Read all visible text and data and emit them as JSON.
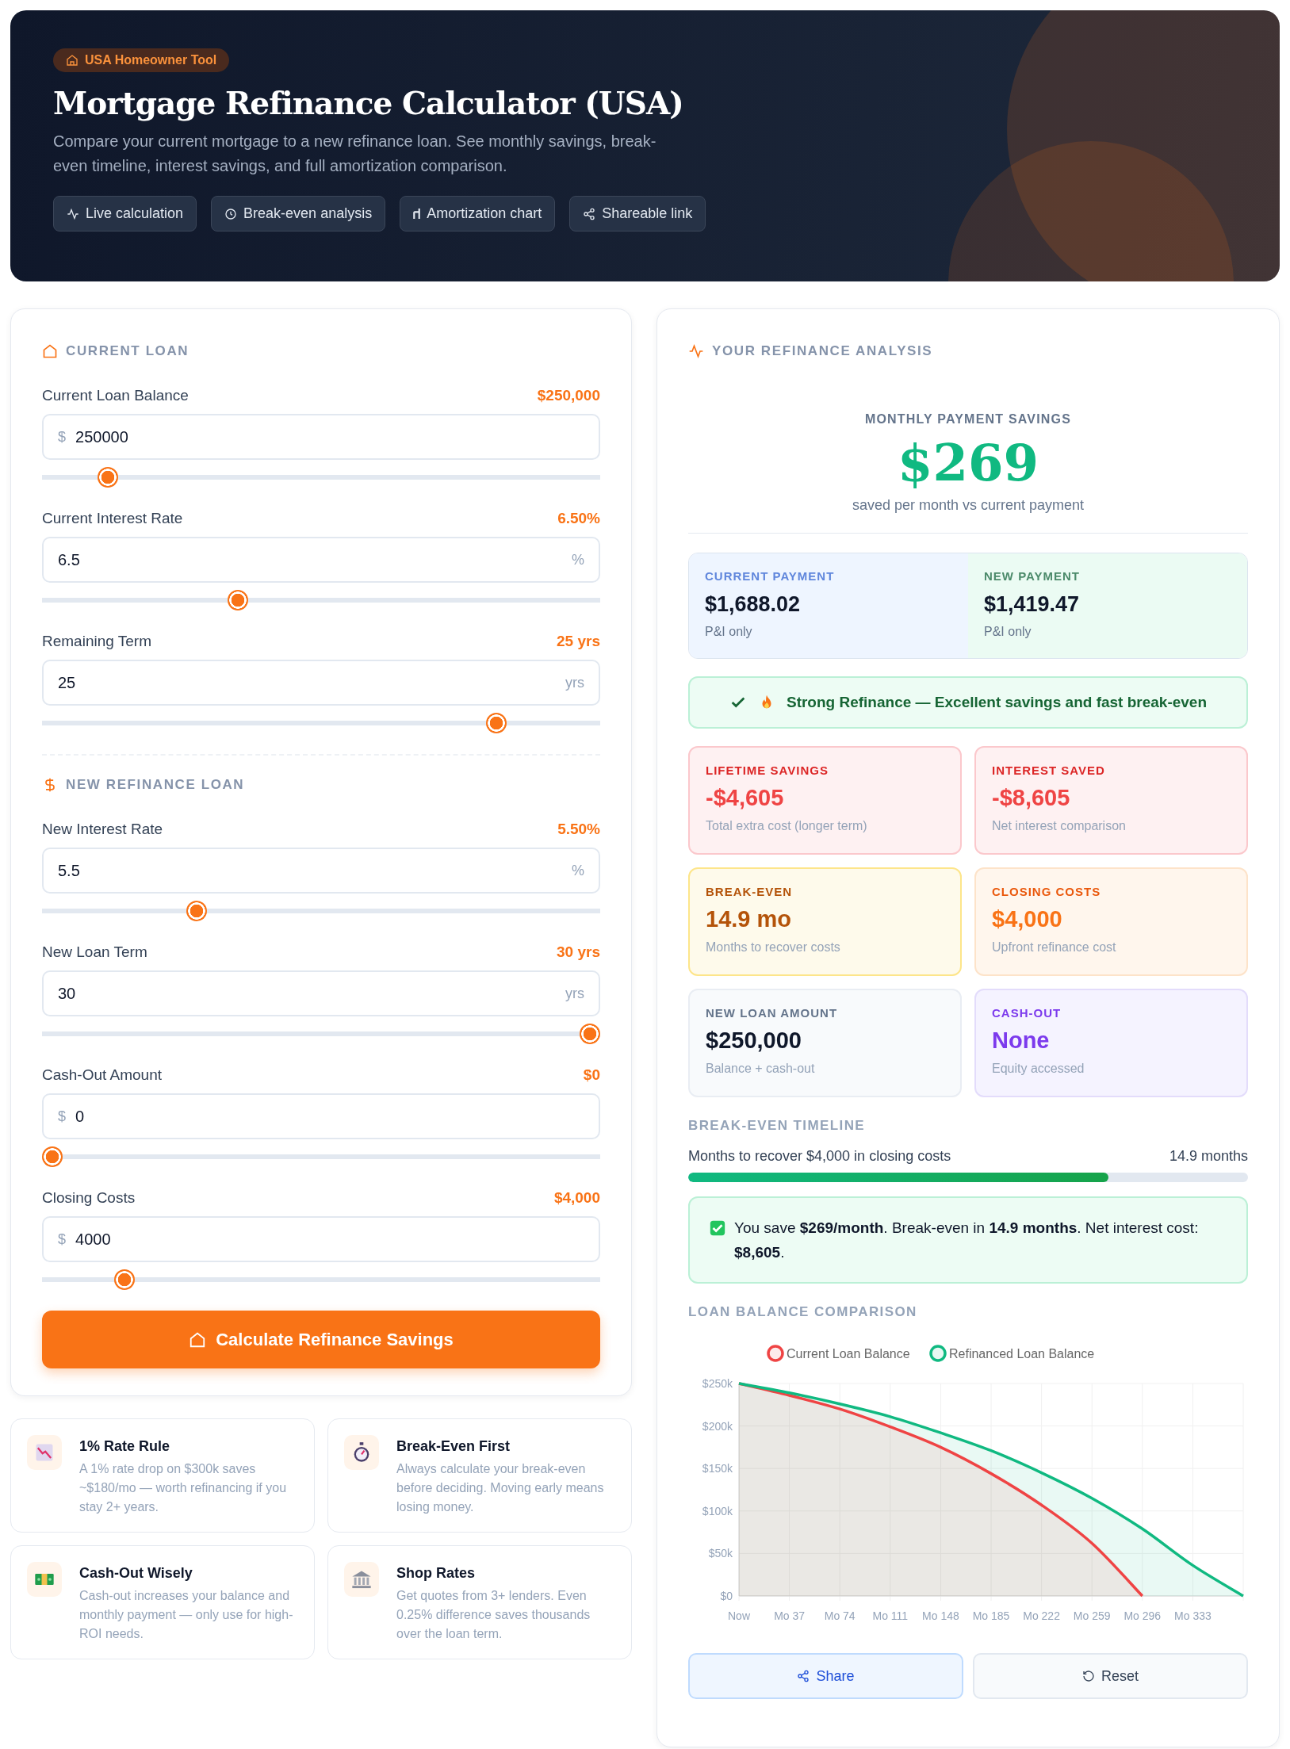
{
  "header": {
    "badge": "USA Homeowner Tool",
    "title": "Mortgage Refinance Calculator (USA)",
    "subtitle": "Compare your current mortgage to a new refinance loan. See monthly savings, break-even timeline, interest savings, and full amortization comparison.",
    "features": [
      "Live calculation",
      "Break-even analysis",
      "Amortization chart",
      "Shareable link"
    ]
  },
  "current_loan": {
    "title": "CURRENT LOAN",
    "fields": [
      {
        "label": "Current Loan Balance",
        "reading": "$250,000",
        "prefix": "$",
        "value": "250000",
        "level": 0.103
      },
      {
        "label": "Current Interest Rate",
        "reading": "6.50%",
        "suffix": "%",
        "value": "6.5",
        "level": 0.345
      },
      {
        "label": "Remaining Term",
        "reading": "25 yrs",
        "suffix": "yrs",
        "value": "25",
        "level": 0.826
      }
    ]
  },
  "new_loan": {
    "title": "NEW REFINANCE LOAN",
    "fields": [
      {
        "label": "New Interest Rate",
        "reading": "5.50%",
        "suffix": "%",
        "value": "5.5",
        "level": 0.269
      },
      {
        "label": "New Loan Term",
        "reading": "30 yrs",
        "suffix": "yrs",
        "value": "30",
        "level": 1.0
      },
      {
        "label": "Cash-Out Amount",
        "reading": "$0",
        "prefix": "$",
        "value": "0",
        "level": 0
      },
      {
        "label": "Closing Costs",
        "reading": "$4,000",
        "prefix": "$",
        "value": "4000",
        "level": 0.134
      }
    ]
  },
  "calculate_button": "Calculate Refinance Savings",
  "tips": [
    {
      "title": "1% Rate Rule",
      "text": "A 1% rate drop on $300k saves ~$180/mo — worth refinancing if you stay 2+ years."
    },
    {
      "title": "Break-Even First",
      "text": "Always calculate your break-even before deciding. Moving early means losing money."
    },
    {
      "title": "Cash-Out Wisely",
      "text": "Cash-out increases your balance and monthly payment — only use for high-ROI needs."
    },
    {
      "title": "Shop Rates",
      "text": "Get quotes from 3+ lenders. Even 0.25% difference saves thousands over the loan term."
    }
  ],
  "analysis": {
    "title": "YOUR REFINANCE ANALYSIS",
    "hero": {
      "label": "MONTHLY PAYMENT SAVINGS",
      "value": "$269",
      "caption": "saved per month vs current payment"
    },
    "payments": [
      {
        "kind": "current",
        "label": "CURRENT PAYMENT",
        "value": "$1,688.02",
        "note": "P&I only"
      },
      {
        "kind": "new",
        "label": "NEW PAYMENT",
        "value": "$1,419.47",
        "note": "P&I only"
      }
    ],
    "verdict": "Strong Refinance — Excellent savings and fast break-even",
    "stats": [
      {
        "kind": "danger",
        "label": "LIFETIME SAVINGS",
        "value": "-$4,605",
        "note": "Total extra cost (longer term)"
      },
      {
        "kind": "danger",
        "label": "INTEREST SAVED",
        "value": "-$8,605",
        "note": "Net interest comparison"
      },
      {
        "kind": "warning",
        "label": "BREAK-EVEN",
        "value": "14.9 mo",
        "note": "Months to recover costs"
      },
      {
        "kind": "orange",
        "label": "CLOSING COSTS",
        "value": "$4,000",
        "note": "Upfront refinance cost"
      },
      {
        "kind": "neutral",
        "label": "NEW LOAN AMOUNT",
        "value": "$250,000",
        "note": "Balance + cash-out"
      },
      {
        "kind": "purple",
        "label": "CASH-OUT",
        "value": "None",
        "note": "Equity accessed"
      }
    ],
    "breakeven": {
      "title": "BREAK-EVEN TIMELINE",
      "label": "Months to recover $4,000 in closing costs",
      "reading": "14.9 months",
      "level": 0.75,
      "note": "You save **$269/month**. Break-even in **14.9 months**. Net interest cost: **$8,605**."
    },
    "chart": {
      "title": "LOAN BALANCE COMPARISON",
      "chart_data": {
        "type": "line",
        "categories": [
          "Now",
          "Mo 37",
          "Mo 74",
          "Mo 111",
          "Mo 148",
          "Mo 185",
          "Mo 222",
          "Mo 259",
          "Mo 296",
          "Mo 333",
          null
        ],
        "series": [
          {
            "name": "Current Loan Balance",
            "color": "#ef4444",
            "values": [
              250000,
              236000,
              220000,
              199000,
              175000,
              144000,
              107000,
              62000,
              0,
              null,
              null
            ]
          },
          {
            "name": "Refinanced Loan Balance",
            "color": "#10b981",
            "values": [
              250000,
              239000,
              226000,
              211000,
              192000,
              171000,
              145000,
              115000,
              79000,
              36000,
              0
            ]
          }
        ],
        "ylim": [
          0,
          250000
        ],
        "grid": true,
        "legend": true,
        "yticks": [
          {
            "value": 0,
            "label": "$0"
          },
          {
            "value": 50000,
            "label": "$50k"
          },
          {
            "value": 100000,
            "label": "$100k"
          },
          {
            "value": 150000,
            "label": "$150k"
          },
          {
            "value": 200000,
            "label": "$200k"
          },
          {
            "value": 250000,
            "label": "$250k"
          }
        ]
      }
    },
    "actions": [
      "Share",
      "Reset"
    ]
  }
}
